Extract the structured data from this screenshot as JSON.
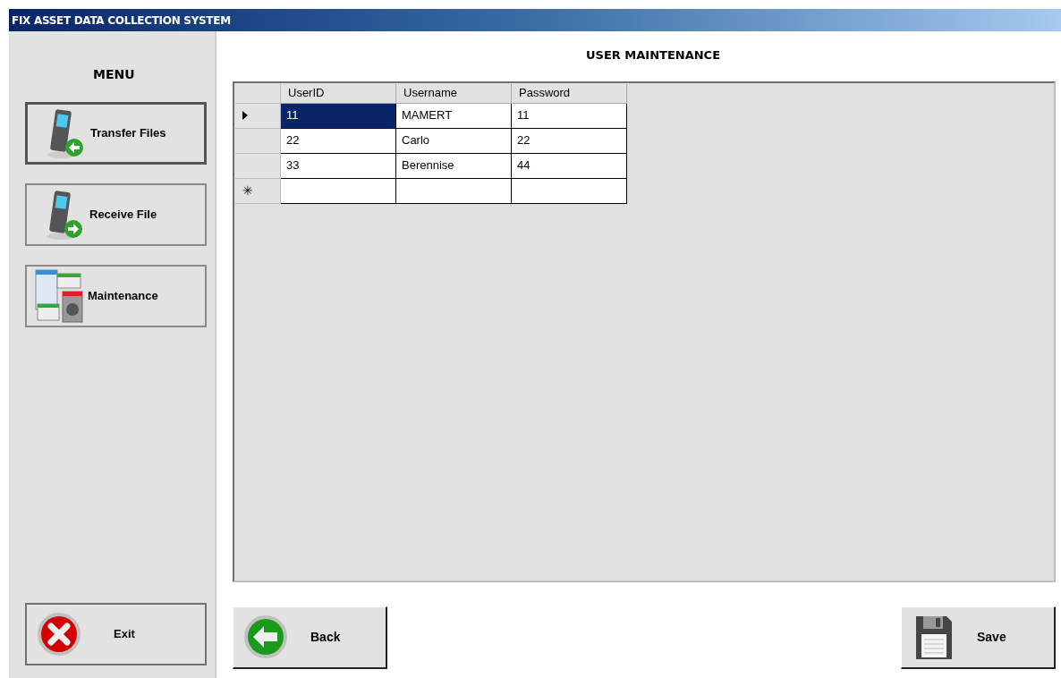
{
  "window": {
    "title": "FIX ASSET DATA COLLECTION SYSTEM"
  },
  "menu": {
    "title": "MENU",
    "items": [
      {
        "label": "Transfer Files",
        "kind": "send",
        "selected": true
      },
      {
        "label": "Receive File",
        "kind": "receive",
        "selected": false
      },
      {
        "label": "Maintenance",
        "kind": "maintenance",
        "selected": false
      }
    ],
    "exit_button": "Exit"
  },
  "page_title": "USER MAINTENANCE",
  "table": {
    "columns": [
      "UserID",
      "Username",
      "Password"
    ],
    "rows": [
      {
        "kind": "data",
        "selected": true,
        "cells": [
          "11",
          "MAMERT",
          "11"
        ]
      },
      {
        "kind": "data",
        "selected": false,
        "cells": [
          "22",
          "Carlo",
          "22"
        ]
      },
      {
        "kind": "data",
        "selected": false,
        "cells": [
          "33",
          "Berennise",
          "44"
        ]
      },
      {
        "kind": "new",
        "selected": false,
        "marker": "✳",
        "cells": []
      }
    ]
  },
  "buttons": {
    "back": "Back",
    "save": "Save"
  }
}
